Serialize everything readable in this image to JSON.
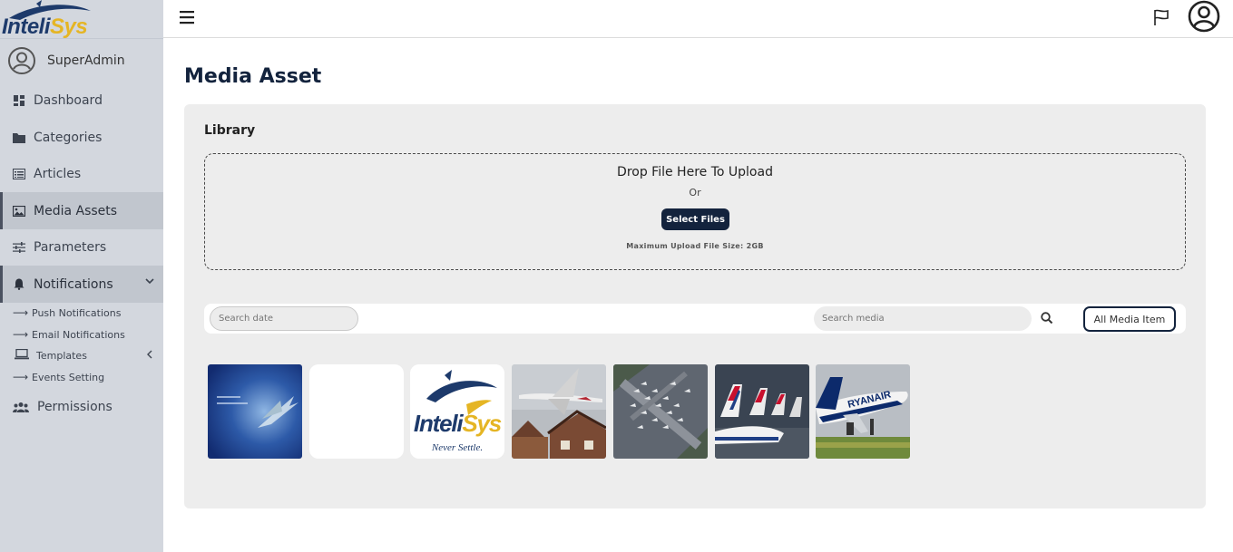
{
  "brand": {
    "logo_text_1": "Inteli",
    "logo_text_2": "Sys"
  },
  "user": {
    "name": "SuperAdmin"
  },
  "sidebar": {
    "items": [
      {
        "label": "Dashboard",
        "icon": "dashboard-icon"
      },
      {
        "label": "Categories",
        "icon": "folder-icon"
      },
      {
        "label": "Articles",
        "icon": "list-icon"
      },
      {
        "label": "Media Assets",
        "icon": "image-icon",
        "active": true
      },
      {
        "label": "Parameters",
        "icon": "sliders-icon"
      },
      {
        "label": "Notifications",
        "icon": "bell-icon",
        "expanded": true
      },
      {
        "label": "Permissions",
        "icon": "users-icon"
      }
    ],
    "sub_items": [
      {
        "label": "Push Notifications",
        "icon": "arrow-right-icon"
      },
      {
        "label": "Email Notifications",
        "icon": "arrow-right-icon"
      },
      {
        "label": "Templates",
        "icon": "laptop-icon"
      },
      {
        "label": "Events Setting",
        "icon": "arrow-right-icon"
      }
    ]
  },
  "topbar": {
    "menu_icon": "hamburger-icon",
    "flag_icon": "flag-icon",
    "account_icon": "account-icon"
  },
  "page": {
    "title": "Media Asset"
  },
  "library": {
    "title": "Library",
    "drop_title": "Drop File Here To Upload",
    "or_text": "Or",
    "select_button": "Select Files",
    "max_size": "Maximum Upload File Size: 2GB"
  },
  "filters": {
    "search_date_placeholder": "Search date",
    "search_media_placeholder": "Search media",
    "all_media_button": "All Media Item"
  },
  "media_items": [
    {
      "name": "blue-airplane-banner"
    },
    {
      "name": "blank-white-image"
    },
    {
      "name": "intelisys-logo",
      "logo_text_1": "Inteli",
      "logo_text_2": "Sys",
      "tagline": "Never Settle."
    },
    {
      "name": "airplane-over-houses"
    },
    {
      "name": "parked-planes-aerial"
    },
    {
      "name": "british-airways-tails"
    },
    {
      "name": "ryanair-takeoff",
      "tail_text": "RYANAIR"
    }
  ],
  "colors": {
    "sidebar_bg": "#d3d7de",
    "navy": "#13233d",
    "panel_bg": "#ededed",
    "logo_blue": "#1d3a6b",
    "logo_gold": "#e5b524"
  }
}
